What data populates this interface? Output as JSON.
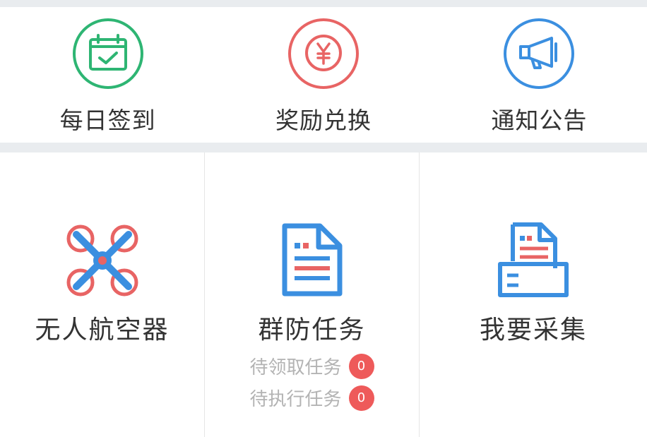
{
  "shortcuts": [
    {
      "label": "每日签到",
      "icon": "calendar-check-icon",
      "color": "#2eb573"
    },
    {
      "label": "奖励兑换",
      "icon": "yen-coin-icon",
      "color": "#e86464"
    },
    {
      "label": "通知公告",
      "icon": "megaphone-icon",
      "color": "#3b8fe0"
    }
  ],
  "modules": [
    {
      "label": "无人航空器",
      "icon": "drone-icon"
    },
    {
      "label": "群防任务",
      "icon": "document-icon",
      "sub_items": [
        {
          "label": "待领取任务",
          "count": "0"
        },
        {
          "label": "待执行任务",
          "count": "0"
        }
      ]
    },
    {
      "label": "我要采集",
      "icon": "document-printer-icon"
    }
  ],
  "colors": {
    "primary_blue": "#3b8fe0",
    "accent_red": "#e86464",
    "green": "#2eb573",
    "badge": "#ee5a5a"
  }
}
